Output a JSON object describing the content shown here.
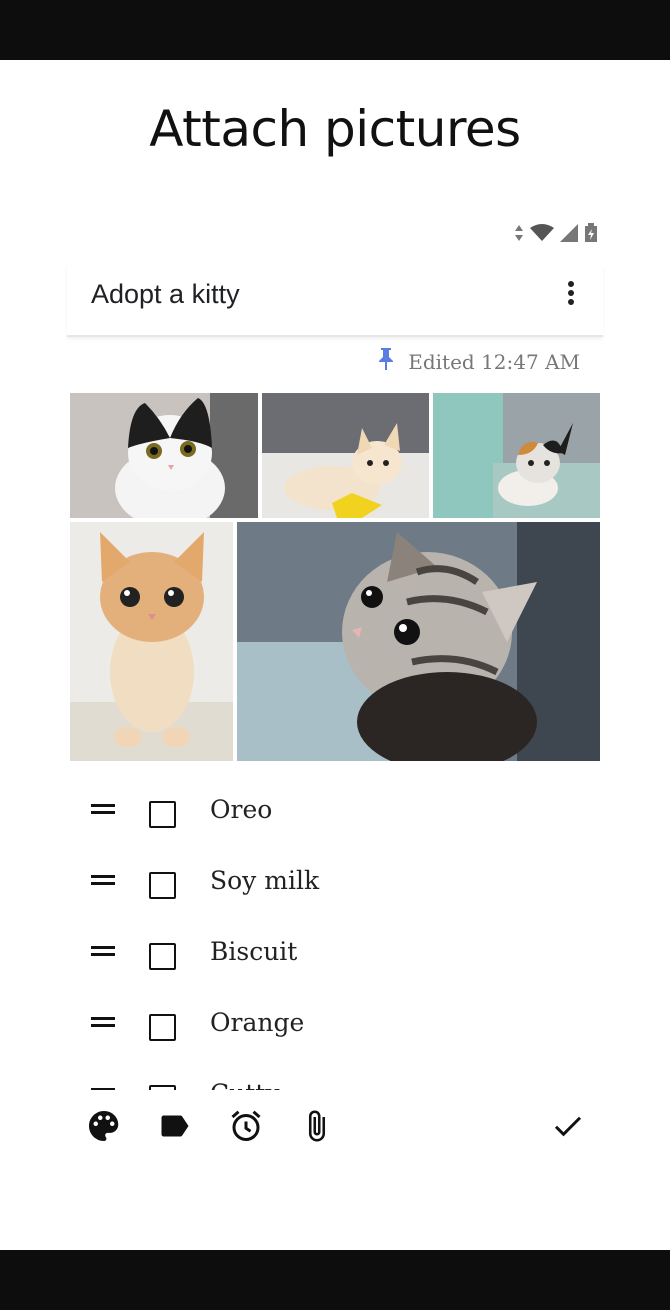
{
  "heading": "Attach pictures",
  "status_icons": [
    "data-arrows-icon",
    "wifi-icon",
    "signal-icon",
    "battery-icon"
  ],
  "note": {
    "title": "Adopt a kitty",
    "edited_text": "Edited 12:47 AM",
    "pin_color": "#5b7de2"
  },
  "photos": [
    {
      "name": "kitten-black-white"
    },
    {
      "name": "kitten-cream-lying"
    },
    {
      "name": "kitten-calico"
    },
    {
      "name": "kitten-orange-standing"
    },
    {
      "name": "kitten-tabby-closeup"
    }
  ],
  "checklist": [
    {
      "label": "Oreo",
      "checked": false
    },
    {
      "label": "Soy milk",
      "checked": false
    },
    {
      "label": "Biscuit",
      "checked": false
    },
    {
      "label": "Orange",
      "checked": false
    },
    {
      "label": "Cutty",
      "checked": false
    }
  ],
  "toolbar": [
    "palette-icon",
    "label-icon",
    "alarm-clock-icon",
    "paperclip-icon",
    "checkmark-icon"
  ]
}
